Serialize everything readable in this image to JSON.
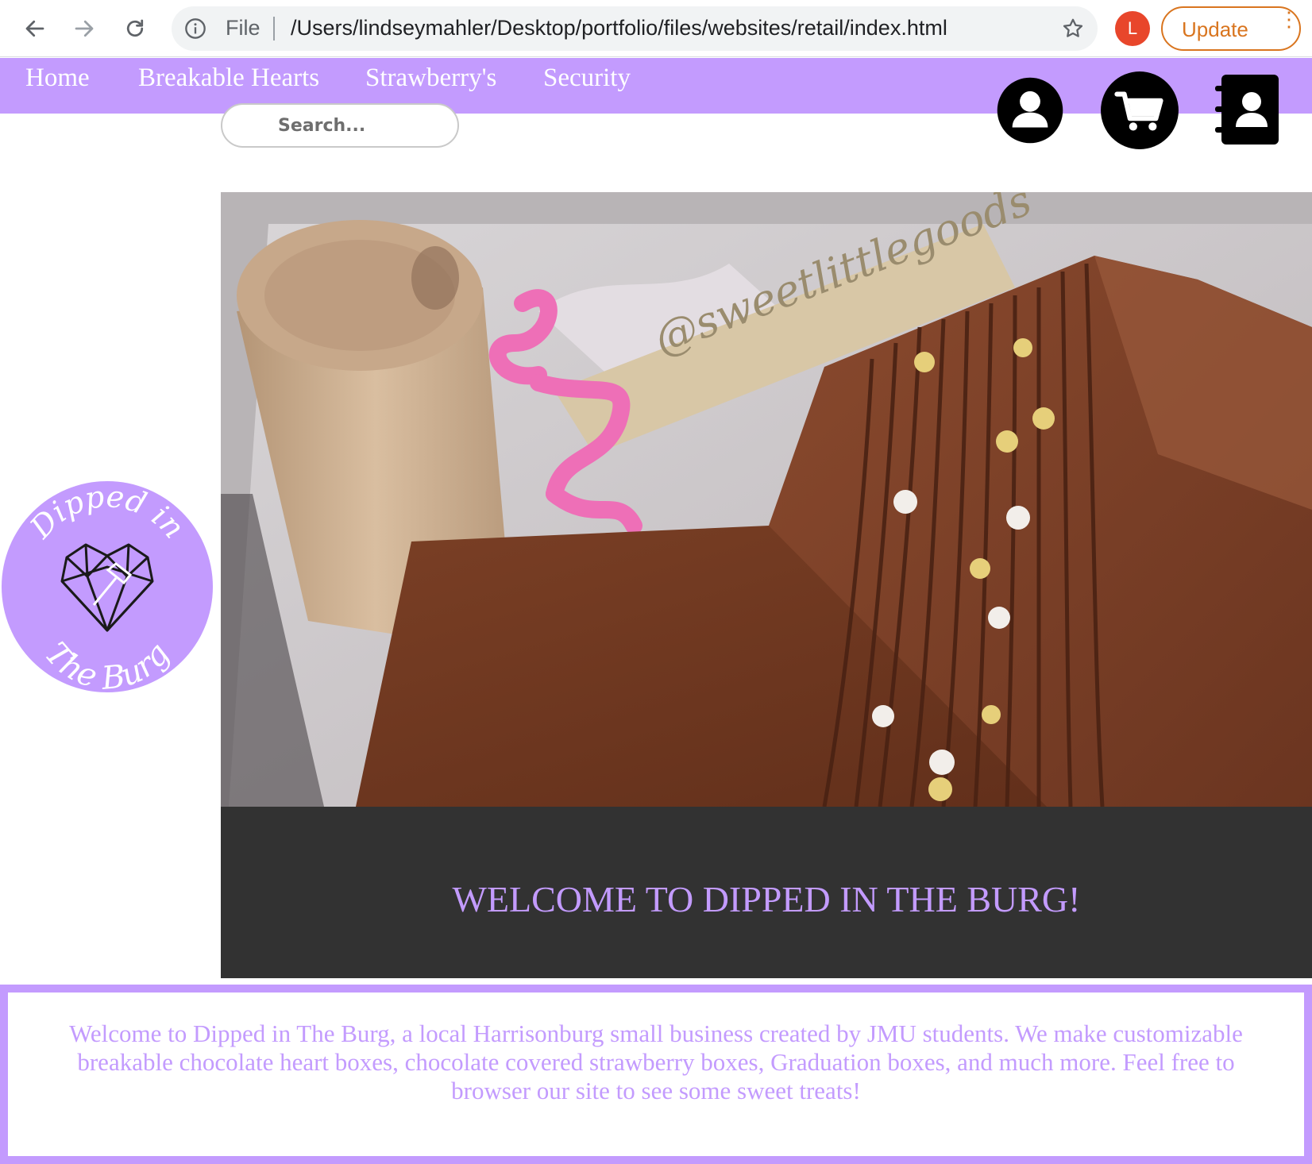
{
  "browser": {
    "file_label": "File",
    "url": "/Users/lindseymahler/Desktop/portfolio/files/websites/retail/index.html",
    "profile_initial": "L",
    "update_label": "Update",
    "menu_glyph": "⋮"
  },
  "nav": {
    "links": [
      "Home",
      "Breakable Hearts",
      "Strawberry's",
      "Security"
    ]
  },
  "search": {
    "placeholder": "Search..."
  },
  "header_icons": [
    "account-icon",
    "cart-icon",
    "contacts-icon"
  ],
  "hero": {
    "image_watermark": "@sweetlittlegoods",
    "title": "WELCOME TO DIPPED IN THE BURG!"
  },
  "logo": {
    "top_text": "Dipped in",
    "bottom_text": "The Burg"
  },
  "welcome": {
    "text": "Welcome to Dipped in The Burg, a local Harrisonburg small business created by JMU students. We make customizable breakable chocolate heart boxes, chocolate covered strawberry boxes, Graduation boxes, and much more. Feel free to browser our site to see some sweet treats!"
  },
  "colors": {
    "brand_purple": "#c39bfe",
    "dark_band": "#323232",
    "update_orange": "#d9751f",
    "profile_red": "#e8462b"
  }
}
